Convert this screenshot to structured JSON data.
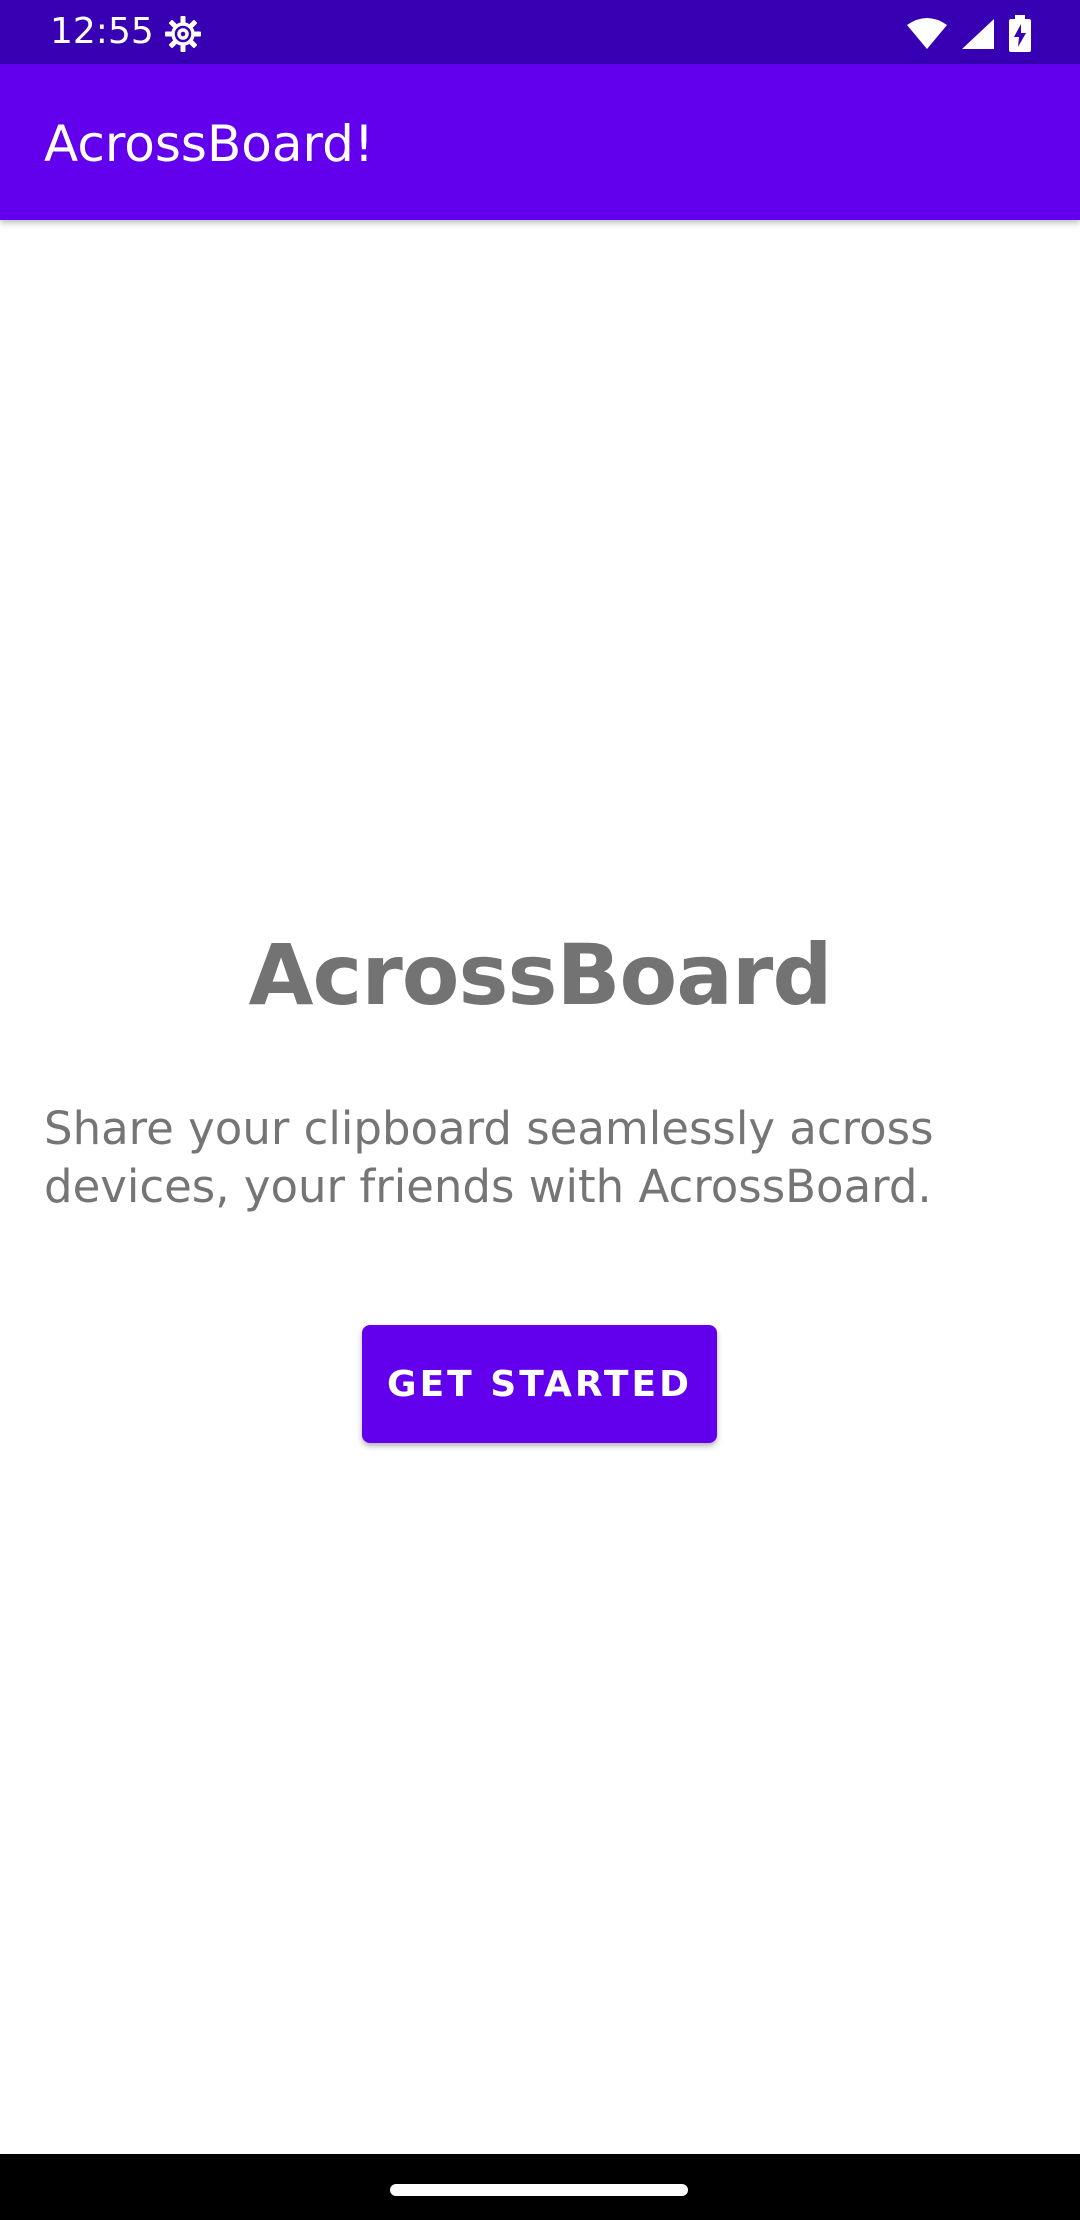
{
  "status_bar": {
    "time": "12:55",
    "icons": [
      "settings-gear-icon",
      "wifi-icon",
      "cell-signal-icon",
      "battery-charging-icon"
    ],
    "color": "#3700B3"
  },
  "app_bar": {
    "title": "AcrossBoard!",
    "color": "#6200EE"
  },
  "main": {
    "title": "AcrossBoard",
    "description": "Share your clipboard seamlessly across devices, your friends with AcrossBoard.",
    "get_started_label": "GET STARTED",
    "accent_color": "#6200EE",
    "text_color": "#757575"
  },
  "nav_bar": {
    "handle": "home-gesture-handle"
  }
}
